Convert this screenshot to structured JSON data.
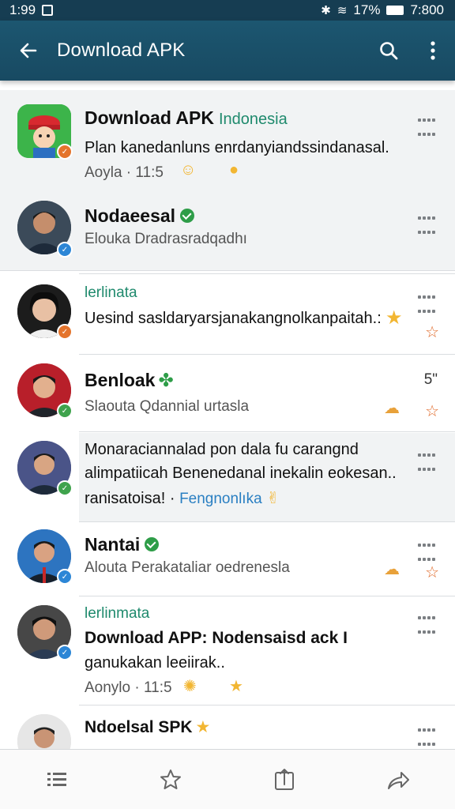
{
  "status_bar": {
    "time": "1:99",
    "battery_percent": "17%",
    "clock_right": "7:800"
  },
  "app_bar": {
    "title": "Download APK",
    "icons": [
      "back-arrow-icon",
      "search-icon",
      "more-vertical-icon"
    ]
  },
  "items": [
    {
      "name": "Download APK",
      "name_suffix": "Indonesia",
      "message": "Plan kanedanluns enrdanyiandssindanasal.",
      "meta": "Aoyla · 11:5",
      "avatar": "app-logo",
      "badge": "orange"
    },
    {
      "name": "Nodaeesal",
      "verified": true,
      "meta": "Elouka   Dradrasradqadhı",
      "avatar": "person",
      "badge": "blue"
    },
    {
      "tag": "lerlinata",
      "message": "Uesind sasldaryarsjanakangnolkanpaitah.:",
      "avatar": "person",
      "badge": "orange"
    },
    {
      "name": "Benloak",
      "meta": "Slaouta   Qdannial urtasla",
      "time": "5\"",
      "avatar": "person",
      "badge": "green"
    },
    {
      "message_lines": [
        "Monaraciannalad pon dala fu carangnd",
        "alimpatiicah Benenedanal inekalin eokesan..",
        "ranisatoisa! · "
      ],
      "link": "Fengnonlıka",
      "avatar": "person",
      "badge": "green"
    },
    {
      "name": "Nantai",
      "verified": true,
      "meta": "Alouta   Perakataliar oedrenesla",
      "avatar": "person",
      "badge": "blue"
    },
    {
      "tag": "lerlinmata",
      "name": "Download APP: Nodensaisd ack I",
      "message": "ganukakan leeiirak..",
      "meta": "Aonylo · 11:5",
      "avatar": "person",
      "badge": "blue"
    },
    {
      "name": "Ndoelsal SPK",
      "avatar": "person",
      "badge": "blue"
    }
  ],
  "bottom_nav": [
    "list-icon",
    "star-outline-icon",
    "share-icon",
    "forward-icon"
  ],
  "colors": {
    "app_bar": "#1c5670",
    "accent_green": "#1f8a6d",
    "link_blue": "#2a7fc2",
    "star_orange": "#e06a2a"
  }
}
